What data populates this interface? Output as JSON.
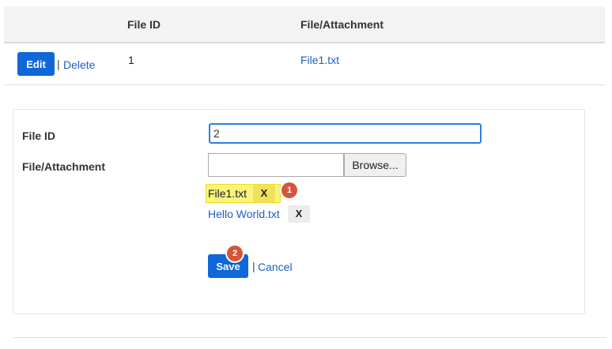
{
  "table": {
    "headers": [
      "File ID",
      "File/Attachment"
    ],
    "rows": [
      {
        "edit_label": "Edit",
        "separator": "|",
        "delete_label": "Delete",
        "file_id": "1",
        "attachment": "File1.txt"
      }
    ]
  },
  "form": {
    "file_id_label": "File ID",
    "file_id_value": "2",
    "attachment_label": "File/Attachment",
    "browse_label": "Browse...",
    "attachments": [
      {
        "name": "File1.txt",
        "remove_label": "X",
        "highlighted": true
      },
      {
        "name": "Hello World.txt",
        "remove_label": "X",
        "highlighted": false
      }
    ],
    "save_label": "Save",
    "separator": "|",
    "cancel_label": "Cancel"
  },
  "annotations": [
    {
      "number": "1"
    },
    {
      "number": "2"
    }
  ],
  "colors": {
    "primary": "#0f67d8",
    "link": "#1f5fbf",
    "highlight": "#fbf37a",
    "badge": "#d4563a",
    "header_bg": "#f3f3f3"
  }
}
